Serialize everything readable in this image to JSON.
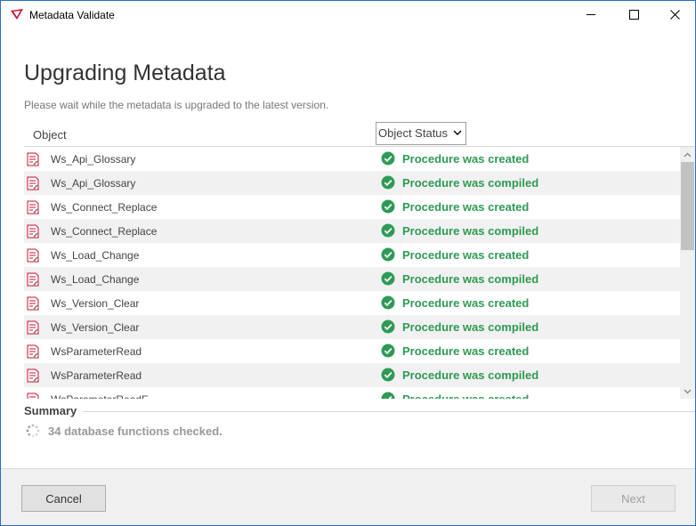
{
  "window": {
    "title": "Metadata Validate",
    "controls": {
      "minimize": "minimize-icon",
      "maximize": "maximize-icon",
      "close": "close-icon"
    }
  },
  "page": {
    "title": "Upgrading Metadata",
    "subtitle": "Please wait while the metadata is upgraded to the latest version."
  },
  "grid": {
    "columns": {
      "object": "Object",
      "status": "Object Status"
    },
    "rows": [
      {
        "object": "Ws_Api_Glossary",
        "status": "Procedure was created"
      },
      {
        "object": "Ws_Api_Glossary",
        "status": "Procedure was compiled"
      },
      {
        "object": "Ws_Connect_Replace",
        "status": "Procedure was created"
      },
      {
        "object": "Ws_Connect_Replace",
        "status": "Procedure was compiled"
      },
      {
        "object": "Ws_Load_Change",
        "status": "Procedure was created"
      },
      {
        "object": "Ws_Load_Change",
        "status": "Procedure was compiled"
      },
      {
        "object": "Ws_Version_Clear",
        "status": "Procedure was created"
      },
      {
        "object": "Ws_Version_Clear",
        "status": "Procedure was compiled"
      },
      {
        "object": "WsParameterRead",
        "status": "Procedure was created"
      },
      {
        "object": "WsParameterRead",
        "status": "Procedure was compiled"
      },
      {
        "object": "WsParameterReadF",
        "status": "Procedure was created"
      }
    ]
  },
  "summary": {
    "title": "Summary",
    "text": "34 database functions checked."
  },
  "buttons": {
    "cancel": "Cancel",
    "next": "Next"
  },
  "colors": {
    "status_success": "#2e9a55",
    "window_border": "#2b6cc4",
    "alt_row": "#f1f1f1"
  }
}
